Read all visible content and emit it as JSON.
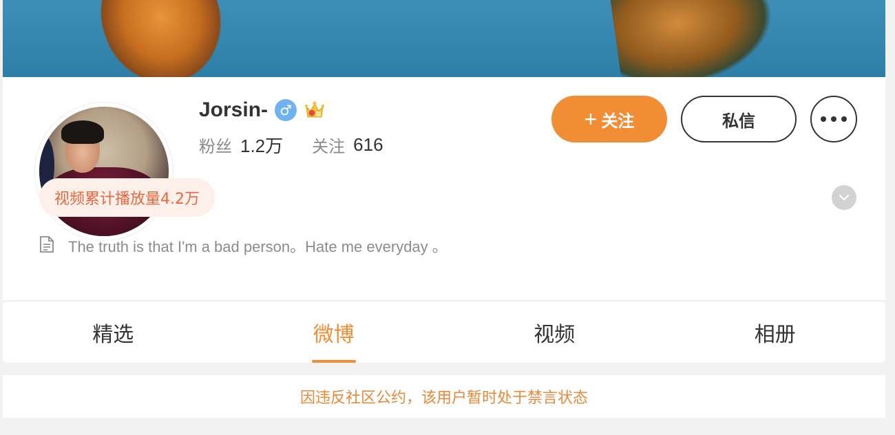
{
  "profile": {
    "name": "Jorsin-",
    "gender_symbol": "♂",
    "stats": {
      "fans_label": "粉丝",
      "fans_value": "1.2万",
      "following_label": "关注",
      "following_value": "616"
    },
    "badge": "视频累计播放量4.2万",
    "bio": "The truth is that I'm a bad person。Hate me everyday 。"
  },
  "actions": {
    "follow_plus": "+",
    "follow_label": "关注",
    "message_label": "私信"
  },
  "tabs": [
    {
      "label": "精选"
    },
    {
      "label": "微博"
    },
    {
      "label": "视频"
    },
    {
      "label": "相册"
    }
  ],
  "notice": "因违反社区公约，该用户暂时处于禁言状态",
  "colors": {
    "accent": "#f08d35",
    "gender_blue": "#6fb2ef",
    "badge_bg": "#fdf0ea",
    "badge_text": "#e6693d"
  }
}
